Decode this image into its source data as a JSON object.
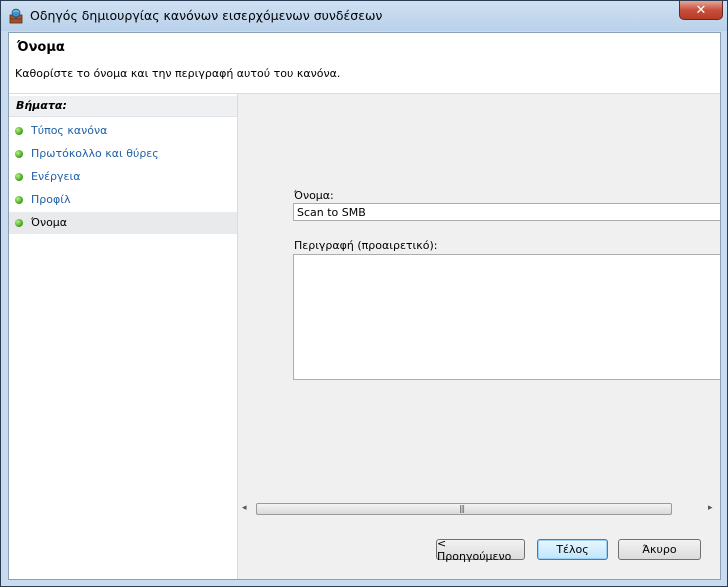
{
  "window": {
    "title": "Οδηγός δημιουργίας κανόνων εισερχόμενων συνδέσεων",
    "close_label": "✕"
  },
  "header": {
    "title": "Όνομα",
    "subtitle": "Καθορίστε το όνομα και την περιγραφή αυτού του κανόνα."
  },
  "steps": {
    "heading": "Βήματα:",
    "items": [
      {
        "label": "Τύπος κανόνα"
      },
      {
        "label": "Πρωτόκολλο και θύρες"
      },
      {
        "label": "Ενέργεια"
      },
      {
        "label": "Προφίλ"
      },
      {
        "label": "Όνομα"
      }
    ]
  },
  "form": {
    "name_label": "Όνομα:",
    "name_value": "Scan to SMB",
    "description_label": "Περιγραφή (προαιρετικό):",
    "description_value": ""
  },
  "scrollbar": {
    "left_arrow": "◂",
    "right_arrow": "▸",
    "grip": "|||"
  },
  "buttons": {
    "back": "< Προηγούμενο",
    "finish": "Τέλος",
    "cancel": "Άκυρο"
  }
}
